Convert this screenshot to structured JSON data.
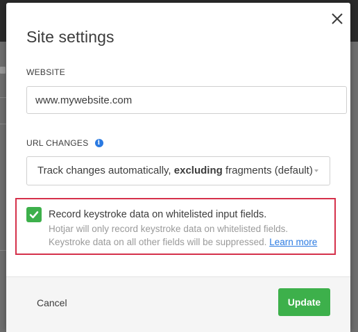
{
  "dialog": {
    "title": "Site settings",
    "close_icon": "close-icon"
  },
  "website": {
    "label": "WEBSITE",
    "value": "www.mywebsite.com"
  },
  "url_changes": {
    "label": "URL CHANGES",
    "info_icon": "info-icon",
    "info_glyph": "i",
    "selected_prefix": "Track changes automatically, ",
    "selected_bold": "excluding",
    "selected_suffix": " fragments (default)",
    "caret_icon": "chevron-down-icon"
  },
  "keystroke": {
    "checked": true,
    "check_icon": "checkmark-icon",
    "title": "Record keystroke data on whitelisted input fields.",
    "desc_line1": "Hotjar will only record keystroke data on whitelisted fields.",
    "desc_line2": "Keystroke data on all other fields will be suppressed.",
    "learn_more": "Learn more"
  },
  "footer": {
    "cancel_label": "Cancel",
    "update_label": "Update"
  },
  "colors": {
    "accent_green": "#3db04b",
    "link_blue": "#2a7ae2",
    "highlight_red": "#d5304a"
  }
}
